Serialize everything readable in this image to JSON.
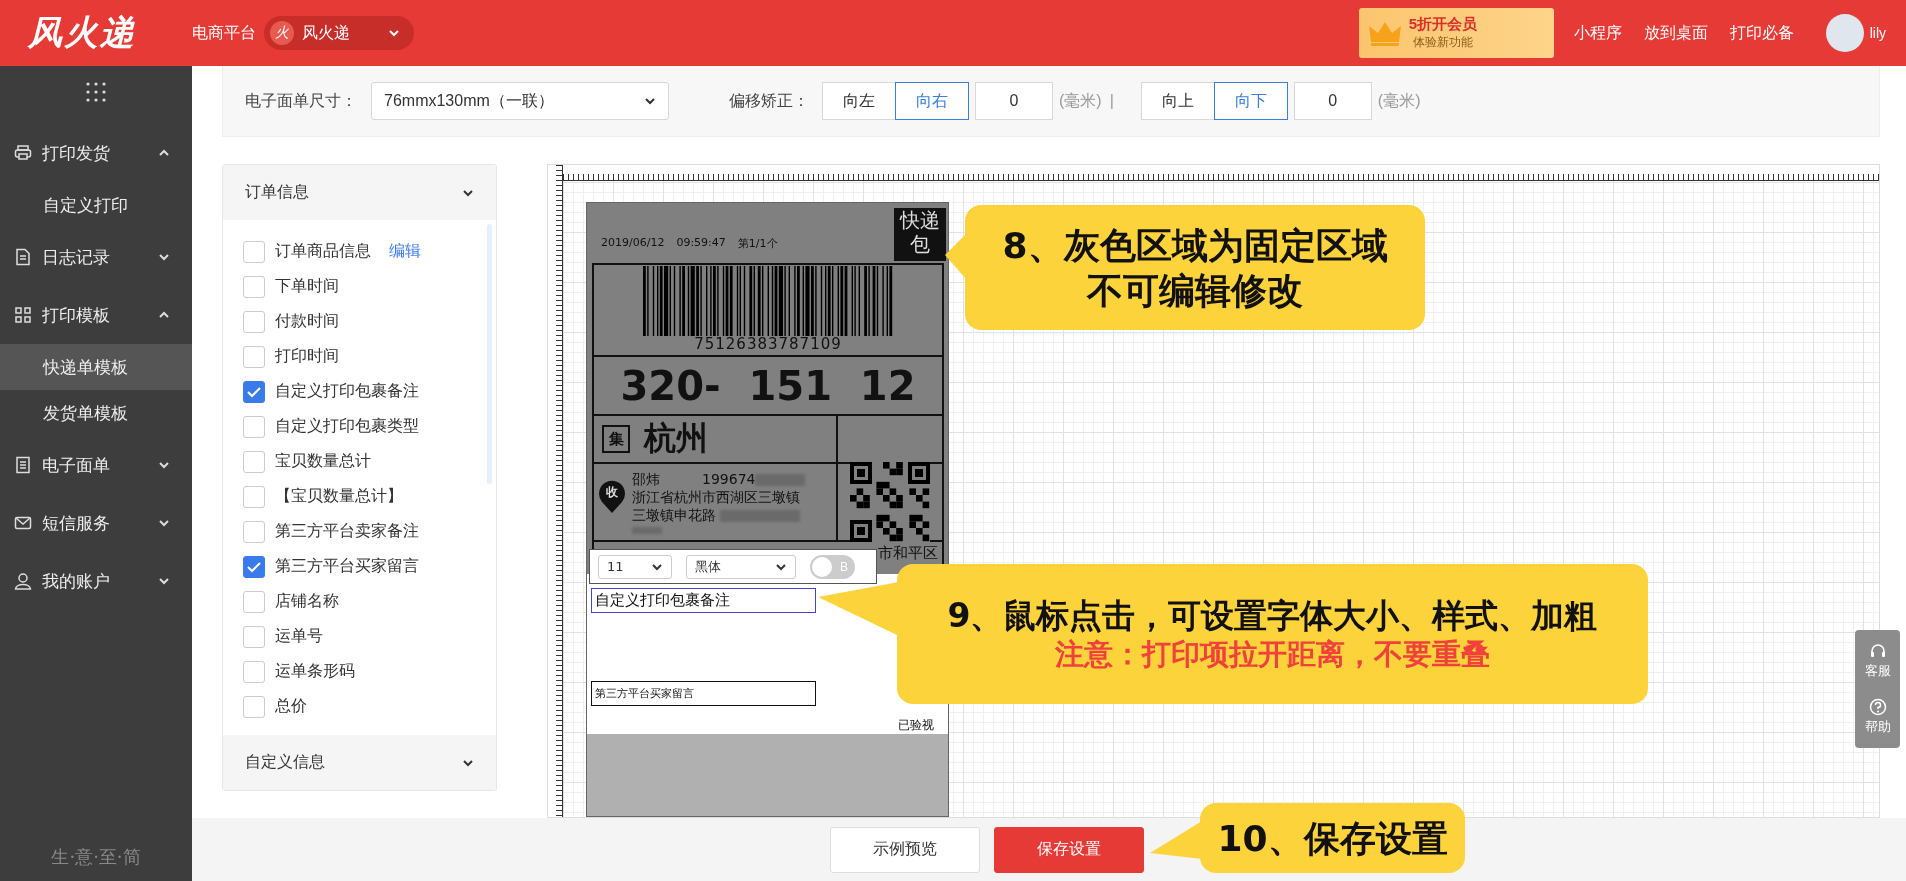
{
  "brand": {
    "logo": "风火递",
    "platform_label": "电商平台",
    "shop_icon": "火",
    "shop": "风火递"
  },
  "promo": {
    "title": "5折开会员",
    "subtitle": "体验新功能"
  },
  "top_links": [
    "小程序",
    "放到桌面",
    "打印必备"
  ],
  "user": {
    "name": "lily"
  },
  "sidebar": {
    "items": [
      {
        "label": "打印发货",
        "expanded": true,
        "children": [
          {
            "label": "自定义打印",
            "selected": false
          }
        ]
      },
      {
        "label": "日志记录",
        "expanded": false
      },
      {
        "label": "打印模板",
        "expanded": true,
        "children": [
          {
            "label": "快递单模板",
            "selected": true
          },
          {
            "label": "发货单模板",
            "selected": false
          }
        ]
      },
      {
        "label": "电子面单",
        "expanded": false
      },
      {
        "label": "短信服务",
        "expanded": false
      },
      {
        "label": "我的账户",
        "expanded": false
      }
    ],
    "slogan": "生·意·至·简"
  },
  "settings": {
    "size_label": "电子面单尺寸：",
    "size_value": "76mmx130mm（一联）",
    "offset_label": "偏移矫正：",
    "horizontal": [
      {
        "label": "向左",
        "selected": false
      },
      {
        "label": "向右",
        "selected": true
      }
    ],
    "h_value": "0",
    "h_unit": "(毫米)",
    "separator": "|",
    "vertical": [
      {
        "label": "向上",
        "selected": false
      },
      {
        "label": "向下",
        "selected": true
      }
    ],
    "v_value": "0",
    "v_unit": "(毫米)"
  },
  "panel": {
    "sections": [
      {
        "title": "订单信息",
        "expanded": true,
        "items": [
          {
            "label": "订单商品信息",
            "checked": false,
            "link": "编辑"
          },
          {
            "label": "下单时间",
            "checked": false
          },
          {
            "label": "付款时间",
            "checked": false
          },
          {
            "label": "打印时间",
            "checked": false
          },
          {
            "label": "自定义打印包裹备注",
            "checked": true
          },
          {
            "label": "自定义打印包裹类型",
            "checked": false
          },
          {
            "label": "宝贝数量总计",
            "checked": false
          },
          {
            "label": "【宝贝数量总计】",
            "checked": false
          },
          {
            "label": "第三方平台卖家备注",
            "checked": false
          },
          {
            "label": "第三方平台买家留言",
            "checked": true
          },
          {
            "label": "店铺名称",
            "checked": false
          },
          {
            "label": "运单号",
            "checked": false
          },
          {
            "label": "运单条形码",
            "checked": false
          },
          {
            "label": "总价",
            "checked": false
          }
        ]
      },
      {
        "title": "自定义信息",
        "expanded": false
      }
    ]
  },
  "label": {
    "date": "2019/06/12",
    "time": "09:59:47",
    "count": "第1/1个",
    "corner": [
      "快递",
      "包"
    ],
    "barcode_number": "75126383787109",
    "sort_code": "320-  151  12",
    "hub_badge": "集",
    "city": "杭州",
    "recipient_badge": "收",
    "recipient_name": "邵炜",
    "recipient_phone": "199674",
    "address_lines": [
      "浙江省杭州市西湖区三墩镇",
      "三墩镇申花路"
    ],
    "district": "市和平区",
    "toolbar": {
      "font_size": "11",
      "font_face": "黑体",
      "bold_label": "B",
      "bold_on": false
    },
    "print_fields": [
      {
        "text": "自定义打印包裹备注",
        "selected": true
      },
      {
        "text": "第三方平台买家留言",
        "selected": false
      }
    ],
    "inspected": "已验视"
  },
  "callouts": [
    {
      "lines": [
        {
          "text": "8、灰色区域为固定区域",
          "kind": "note"
        },
        {
          "text": "不可编辑修改",
          "kind": "note"
        }
      ]
    },
    {
      "lines": [
        {
          "text": "9、鼠标点击，可设置字体大小、样式、加粗",
          "kind": "note"
        },
        {
          "text": "注意：打印项拉开距离，不要重叠",
          "kind": "warning"
        }
      ]
    },
    {
      "lines": [
        {
          "text": "10、保存设置",
          "kind": "note"
        }
      ]
    }
  ],
  "float_tools": [
    {
      "label": "客服"
    },
    {
      "label": "帮助"
    }
  ],
  "footer": {
    "buttons": [
      {
        "label": "示例预览",
        "kind": "default"
      },
      {
        "label": "保存设置",
        "kind": "primary"
      }
    ]
  }
}
